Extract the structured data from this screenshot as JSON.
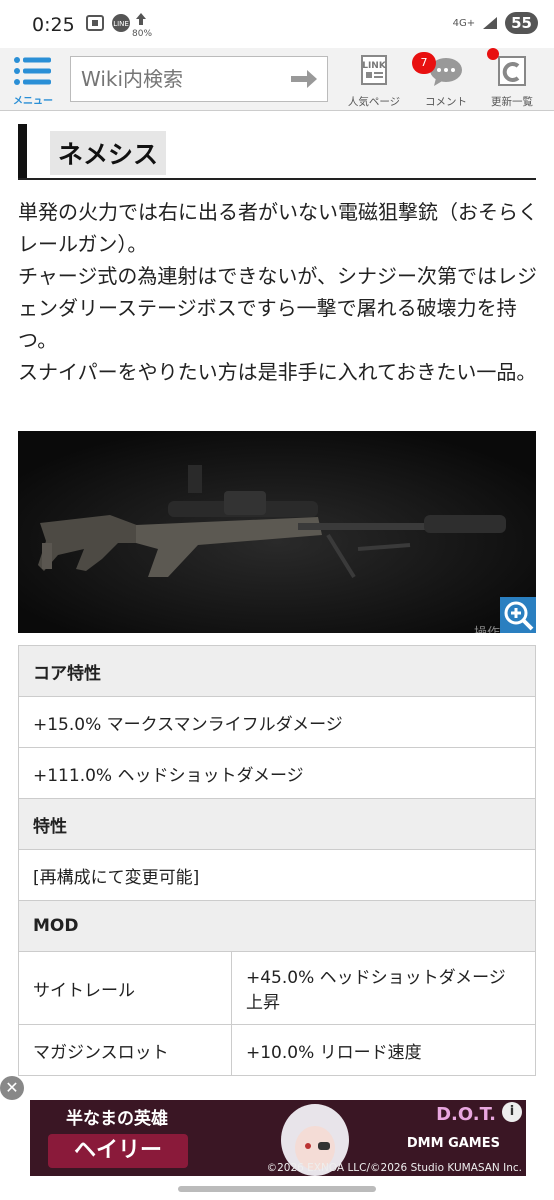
{
  "status_bar": {
    "time": "0:25",
    "network": "4G+",
    "battery": "55",
    "data_pct": "80%"
  },
  "header": {
    "menu_label": "メニュー",
    "search_placeholder": "Wiki内検索",
    "buttons": [
      {
        "label": "人気ページ",
        "icon": "link-icon"
      },
      {
        "label": "コメント",
        "icon": "comment-icon",
        "badge": "7"
      },
      {
        "label": "更新一覧",
        "icon": "refresh-icon"
      }
    ]
  },
  "article": {
    "title": "ネメシス",
    "paragraphs": [
      "単発の火力では右に出る者がいない電磁狙撃銃（おそらくレールガン）。",
      "チャージ式の為連射はできないが、シナジー次第ではレジェンダリーステージボスですら一撃で屠れる破壊力を持つ。",
      "スナイパーをやりたい方は是非手に入れておきたい一品。"
    ],
    "image_caption": "操作"
  },
  "table": {
    "core_header": "コア特性",
    "core_rows": [
      "+15.0% マークスマンライフルダメージ",
      "+111.0% ヘッドショットダメージ"
    ],
    "trait_header": "特性",
    "trait_rows": [
      "[再構成にて変更可能]"
    ],
    "mod_header": "MOD",
    "mod_rows": [
      {
        "slot": "サイトレール",
        "effect": "+45.0% ヘッドショットダメージ上昇"
      },
      {
        "slot": "マガジンスロット",
        "effect": "+10.0% リロード速度"
      }
    ]
  },
  "ad": {
    "line1": "半なまの英雄",
    "line2": "ヘイリー",
    "brand": "D.O.T.",
    "publisher": "DMM GAMES",
    "copyright": "©2026 EXNOA LLC/©2026 Studio KUMASAN Inc."
  },
  "colors": {
    "accent": "#2a8fd6",
    "badge": "#e81010",
    "header_bg": "#f2f2f2"
  }
}
